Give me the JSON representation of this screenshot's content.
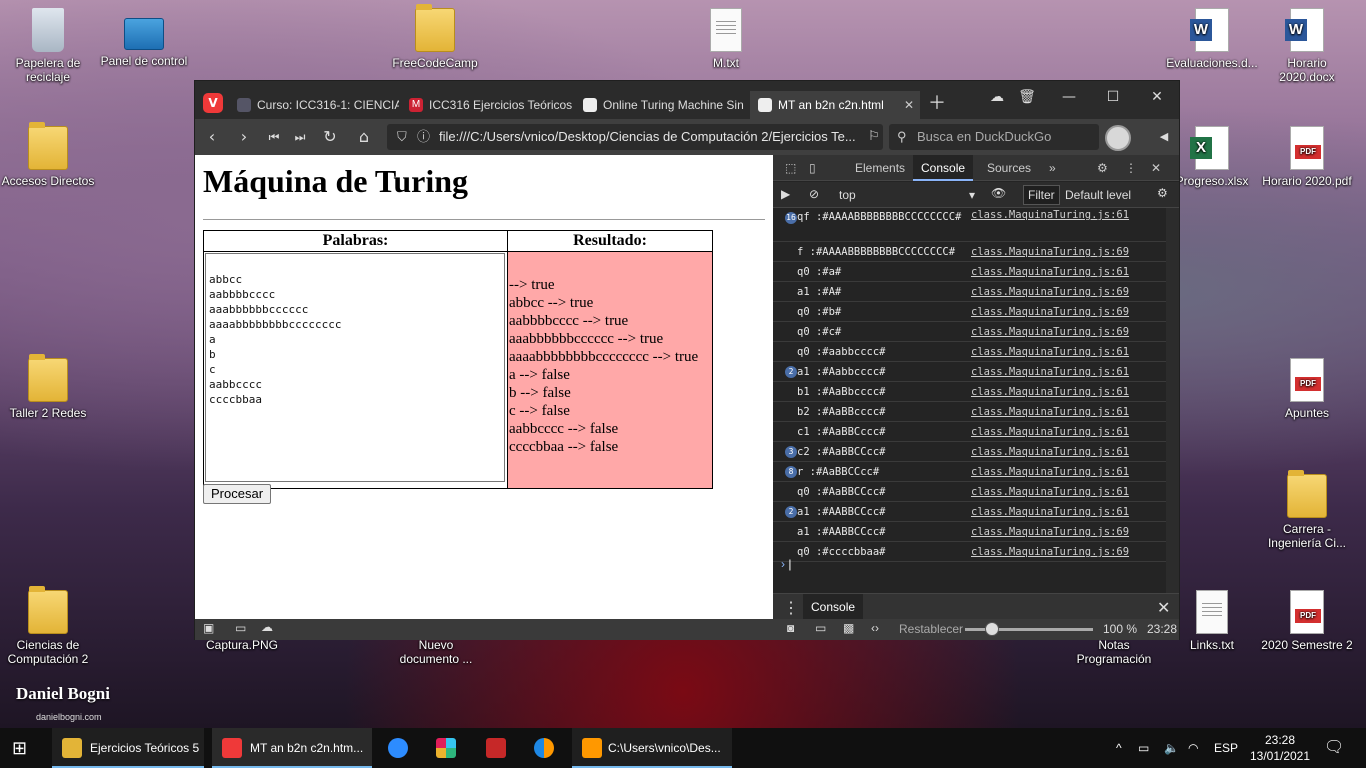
{
  "desktop": {
    "icons": [
      {
        "name": "papelera-de-reciclaje",
        "label": "Papelera de reciclaje"
      },
      {
        "name": "panel-de-control",
        "label": "Panel de control"
      },
      {
        "name": "freecodecamp",
        "label": "FreeCodeCamp"
      },
      {
        "name": "m-txt",
        "label": "M.txt"
      },
      {
        "name": "evaluaciones",
        "label": "Evaluaciones.d..."
      },
      {
        "name": "horario-2020-docx",
        "label": "Horario 2020.docx"
      },
      {
        "name": "accesos-directos",
        "label": "Accesos Directos"
      },
      {
        "name": "progreso-xlsx",
        "label": "Progreso.xlsx"
      },
      {
        "name": "horario-2020-pdf",
        "label": "Horario 2020.pdf"
      },
      {
        "name": "taller-2-redes",
        "label": "Taller 2 Redes"
      },
      {
        "name": "apuntes",
        "label": "Apuntes"
      },
      {
        "name": "carrera-ingenieria",
        "label": "Carrera - Ingeniería Ci..."
      },
      {
        "name": "ciencias-de-computacion-2",
        "label": "Ciencias de Computación 2"
      },
      {
        "name": "captura-png",
        "label": "Captura.PNG"
      },
      {
        "name": "nuevo-documento",
        "label": "Nuevo documento ..."
      },
      {
        "name": "notas-programacion",
        "label": "Notas Programación"
      },
      {
        "name": "links-txt",
        "label": "Links.txt"
      },
      {
        "name": "2020-semestre-2",
        "label": "2020 Semestre 2"
      }
    ],
    "watermark": "Daniel Bogni",
    "watermark_url": "danielbogni.com"
  },
  "browser": {
    "tabs": [
      {
        "label": "Curso: ICC316-1: CIENCIAS"
      },
      {
        "label": "ICC316 Ejercicios Teóricos"
      },
      {
        "label": "Online Turing Machine Sin"
      },
      {
        "label": "MT an b2n c2n.html"
      }
    ],
    "url": "file:///C:/Users/vnico/Desktop/Ciencias de Computación 2/Ejercicios Te...",
    "search_placeholder": "Busca en DuckDuckGo"
  },
  "page": {
    "title": "Máquina de Turing",
    "col_words": "Palabras:",
    "col_result": "Resultado:",
    "words_text": "abbcc\naabbbbcccc\naaabbbbbbcccccc\naaaabbbbbbbbcccccccc\na\nb\nc\naabbcccc\nccccbbaa",
    "results": [
      "--> true",
      "abbcc --> true",
      "aabbbbcccc --> true",
      "aaabbbbbbcccccc --> true",
      "aaaabbbbbbbbcccccccc --> true",
      "a --> false",
      "b --> false",
      "c --> false",
      "aabbcccc --> false",
      "ccccbbaa --> false"
    ],
    "process_button": "Procesar"
  },
  "devtools": {
    "tabs": [
      "Elements",
      "Console",
      "Sources"
    ],
    "context": "top",
    "filter_label": "Filter",
    "level_label": "Default level",
    "lines": [
      {
        "count": "16",
        "msg": "qf :#AAAABBBBBBBBCCCCCCCC#",
        "src": "class.MaquinaTuring.js:61"
      },
      {
        "count": "",
        "msg": "f :#AAAABBBBBBBBCCCCCCCC#",
        "src": "class.MaquinaTuring.js:69"
      },
      {
        "count": "",
        "msg": "q0 :#a#",
        "src": "class.MaquinaTuring.js:61"
      },
      {
        "count": "",
        "msg": "a1 :#A#",
        "src": "class.MaquinaTuring.js:69"
      },
      {
        "count": "",
        "msg": "q0 :#b#",
        "src": "class.MaquinaTuring.js:69"
      },
      {
        "count": "",
        "msg": "q0 :#c#",
        "src": "class.MaquinaTuring.js:69"
      },
      {
        "count": "",
        "msg": "q0 :#aabbcccc#",
        "src": "class.MaquinaTuring.js:61"
      },
      {
        "count": "2",
        "msg": "a1 :#Aabbcccc#",
        "src": "class.MaquinaTuring.js:61"
      },
      {
        "count": "",
        "msg": "b1 :#AaBbcccc#",
        "src": "class.MaquinaTuring.js:61"
      },
      {
        "count": "",
        "msg": "b2 :#AaBBcccc#",
        "src": "class.MaquinaTuring.js:61"
      },
      {
        "count": "",
        "msg": "c1 :#AaBBCccc#",
        "src": "class.MaquinaTuring.js:61"
      },
      {
        "count": "3",
        "msg": "c2 :#AaBBCCcc#",
        "src": "class.MaquinaTuring.js:61"
      },
      {
        "count": "8",
        "msg": "r :#AaBBCCcc#",
        "src": "class.MaquinaTuring.js:61"
      },
      {
        "count": "",
        "msg": "q0 :#AaBBCCcc#",
        "src": "class.MaquinaTuring.js:61"
      },
      {
        "count": "2",
        "msg": "a1 :#AABBCCcc#",
        "src": "class.MaquinaTuring.js:61"
      },
      {
        "count": "",
        "msg": "a1 :#AABBCCcc#",
        "src": "class.MaquinaTuring.js:69"
      },
      {
        "count": "",
        "msg": "q0 :#ccccbbaa#",
        "src": "class.MaquinaTuring.js:69"
      }
    ],
    "drawer_tab": "Console"
  },
  "statusbar": {
    "reset_label": "Restablecer",
    "zoom": "100 %",
    "clock": "23:28"
  },
  "taskbar": {
    "items": [
      {
        "label": "Ejercicios Teóricos 5"
      },
      {
        "label": "MT an b2n c2n.htm..."
      },
      {
        "label": "C:\\Users\\vnico\\Des..."
      }
    ],
    "lang": "ESP",
    "time": "23:28",
    "date": "13/01/2021"
  },
  "colors": {
    "result_bg": "#ffa8a8",
    "vivaldi_red": "#ef3939",
    "devtools_bg": "#242424"
  }
}
